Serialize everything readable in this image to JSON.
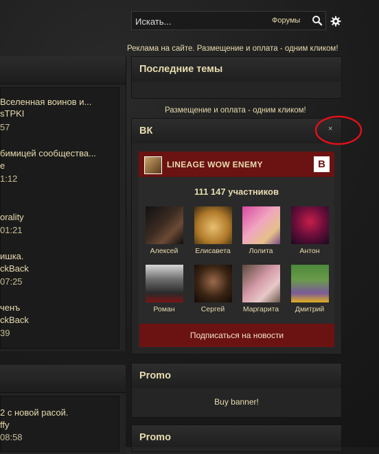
{
  "left": {
    "lines1": [
      "Вселенная воинов и...",
      "sTPKI",
      "57",
      "бимицей сообщества...",
      "е",
      "1:12",
      "orality",
      "01:21",
      "ишка.",
      "ckBack",
      "07:25",
      "ченъ",
      "ckBack",
      "39"
    ],
    "lines2": [
      "2 с новой расой.",
      "ffy",
      "08:58"
    ]
  },
  "search": {
    "placeholder": "Искать...",
    "scope": "Форумы"
  },
  "ad": {
    "text1": "Реклама на сайте. Размещение и оплата - одним кликом!",
    "text2": "Размещение и оплата - одним кликом!"
  },
  "blocks": {
    "latest": "Последние темы",
    "vk": "ВК",
    "promo1": "Promo",
    "promo1_body": "Buy banner!",
    "promo2": "Promo"
  },
  "vk": {
    "group_name": "LINEAGE WOW ENEMY",
    "logo": "B",
    "members": "111 147 участников",
    "close": "×",
    "subscribe": "Подписаться на новости",
    "people": [
      "Алексей",
      "Елисавета",
      "Лолита",
      "Антон",
      "Роман",
      "Сергей",
      "Маргарита",
      "Дмитрий"
    ]
  },
  "colors": {
    "accent": "#6b1212",
    "text": "#e8dcb0",
    "annotation": "#e0101a"
  }
}
